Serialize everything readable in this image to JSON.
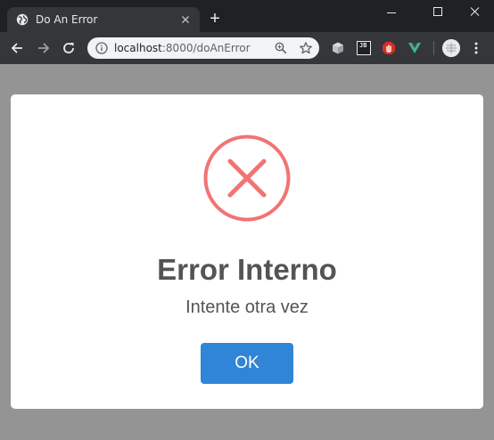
{
  "browser": {
    "tab_title": "Do An Error",
    "new_tab_symbol": "+",
    "url_host": "localhost",
    "url_rest": ":8000/doAnError",
    "icons": {
      "favicon": "globe-icon",
      "close": "close-icon",
      "back": "back-arrow-icon",
      "forward": "forward-arrow-icon",
      "reload": "reload-icon",
      "info": "info-icon",
      "zoom": "zoom-icon",
      "bookmark": "star-icon",
      "menu": "kebab-menu-icon"
    },
    "extensions": [
      {
        "name": "box-extension-icon",
        "label": ""
      },
      {
        "name": "jb-extension-icon",
        "label": "JB"
      },
      {
        "name": "stop-hand-extension-icon",
        "label": ""
      },
      {
        "name": "vue-devtools-extension-icon",
        "label": ""
      }
    ]
  },
  "dialog": {
    "icon": "error-x-icon",
    "icon_color": "#f27474",
    "title": "Error Interno",
    "text": "Intente otra vez",
    "ok_label": "OK",
    "ok_color": "#3085d6"
  }
}
